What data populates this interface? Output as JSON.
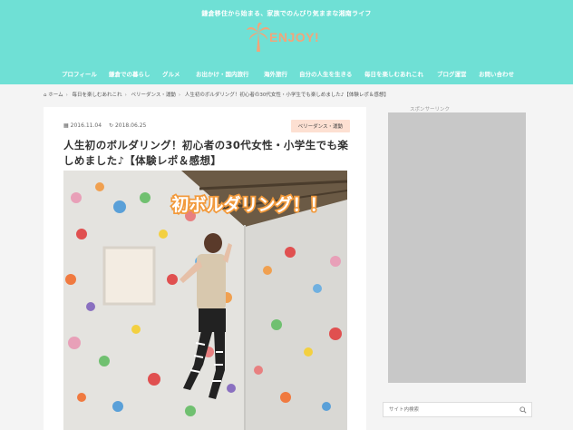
{
  "header": {
    "tagline": "鎌倉移住から始まる、家族でのんびり気ままな湘南ライフ",
    "logo_text": "ENJOY!"
  },
  "nav": {
    "items": [
      {
        "label": "プロフィール"
      },
      {
        "label": "鎌倉での暮らし"
      },
      {
        "label": "グルメ"
      },
      {
        "label": "お出かけ・国内旅行"
      },
      {
        "label": "海外旅行"
      },
      {
        "label": "自分の人生を生きる"
      },
      {
        "label": "毎日を楽しむあれこれ"
      },
      {
        "label": "ブログ運営"
      },
      {
        "label": "お問い合わせ"
      }
    ]
  },
  "breadcrumb": {
    "home": "ホーム",
    "cat1": "毎日を楽しむあれこれ",
    "cat2": "ベリーダンス・運動",
    "current": "人生初のボルダリング！初心者の30代女性・小学生でも楽しめました♪【体験レポ＆感想】"
  },
  "article": {
    "published": "2016.11.04",
    "updated": "2018.06.25",
    "category": "ベリーダンス・運動",
    "title": "人生初のボルダリング！初心者の30代女性・小学生でも楽しめました♪【体験レポ＆感想】",
    "photo_caption": "初ボルダリング！！"
  },
  "sidebar": {
    "sponsor_label": "スポンサーリンク",
    "search_placeholder": "サイト内検索"
  },
  "colors": {
    "header_bg": "#6fe0d5",
    "logo": "#f2a57a",
    "badge_bg": "#fde0d2",
    "ad_bg": "#c8c8c8"
  }
}
